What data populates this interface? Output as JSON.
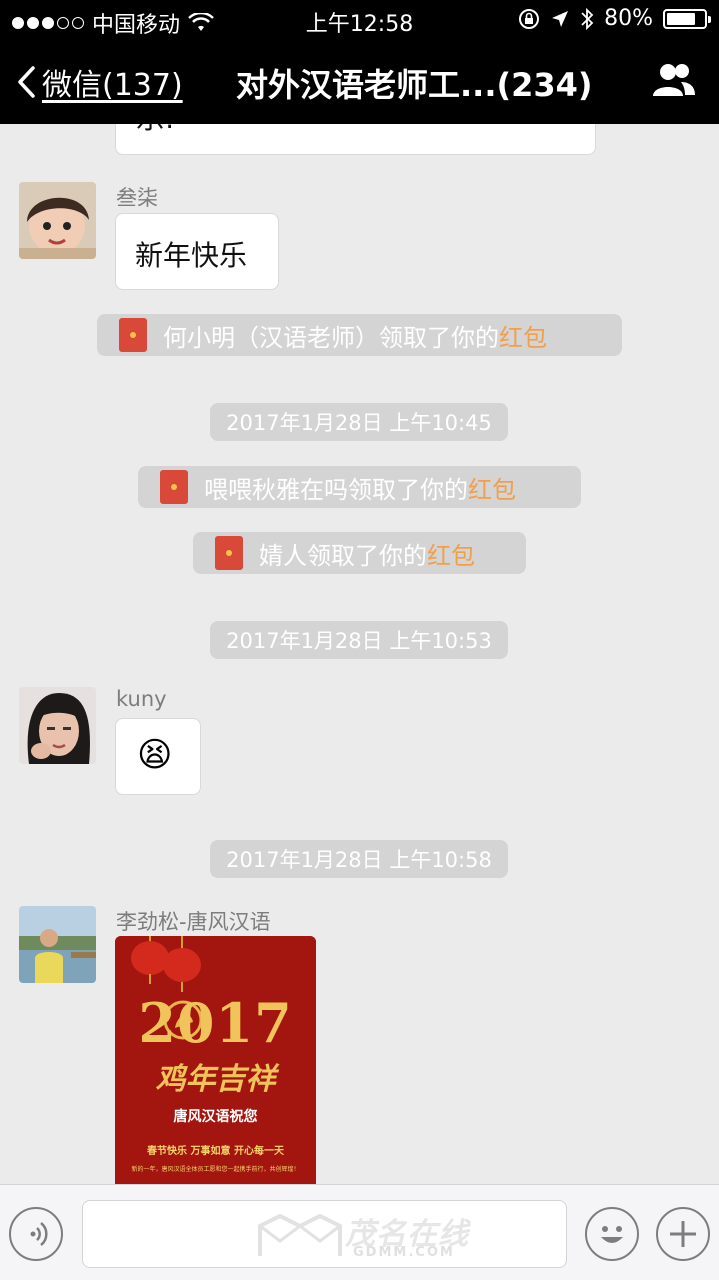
{
  "status_bar": {
    "carrier": "中国移动",
    "time": "上午12:58",
    "battery_percent": "80%",
    "battery_level": 0.8
  },
  "nav": {
    "back_label": "微信(137)",
    "title": "对外汉语老师工...(234)"
  },
  "messages": [
    {
      "type": "bubble-partial",
      "text": "乐!"
    },
    {
      "type": "text",
      "sender": "叁柒",
      "text": "新年快乐"
    },
    {
      "type": "system",
      "prefix": "何小明（汉语老师）领取了你的",
      "link": "红包"
    },
    {
      "type": "timestamp",
      "text": "2017年1月28日 上午10:45"
    },
    {
      "type": "system",
      "prefix": "喂喂秋雅在吗领取了你的",
      "link": "红包"
    },
    {
      "type": "system",
      "prefix": "婧人领取了你的",
      "link": "红包"
    },
    {
      "type": "timestamp",
      "text": "2017年1月28日 上午10:53"
    },
    {
      "type": "emoji",
      "sender": "kuny",
      "emoji": "😫"
    },
    {
      "type": "timestamp",
      "text": "2017年1月28日 上午10:58"
    },
    {
      "type": "image",
      "sender": "李劲松-唐风汉语",
      "poster": {
        "year": "2017",
        "headline": "鸡年吉祥",
        "greeting": "唐风汉语祝您",
        "wishes": "春节快乐  万事如意  开心每一天",
        "small": "新的一年，唐风汉语全体员工愿和您一起携手前行，共创辉煌！"
      }
    }
  ],
  "input": {
    "watermark": "茂名在线",
    "watermark_sub": "GDMM.COM"
  },
  "colors": {
    "nav_bg": "#000000",
    "chat_bg": "#ebebeb",
    "system_chip": "#d4d4d4",
    "red_packet": "#d8493a",
    "red_packet_link": "#f0a04b"
  }
}
